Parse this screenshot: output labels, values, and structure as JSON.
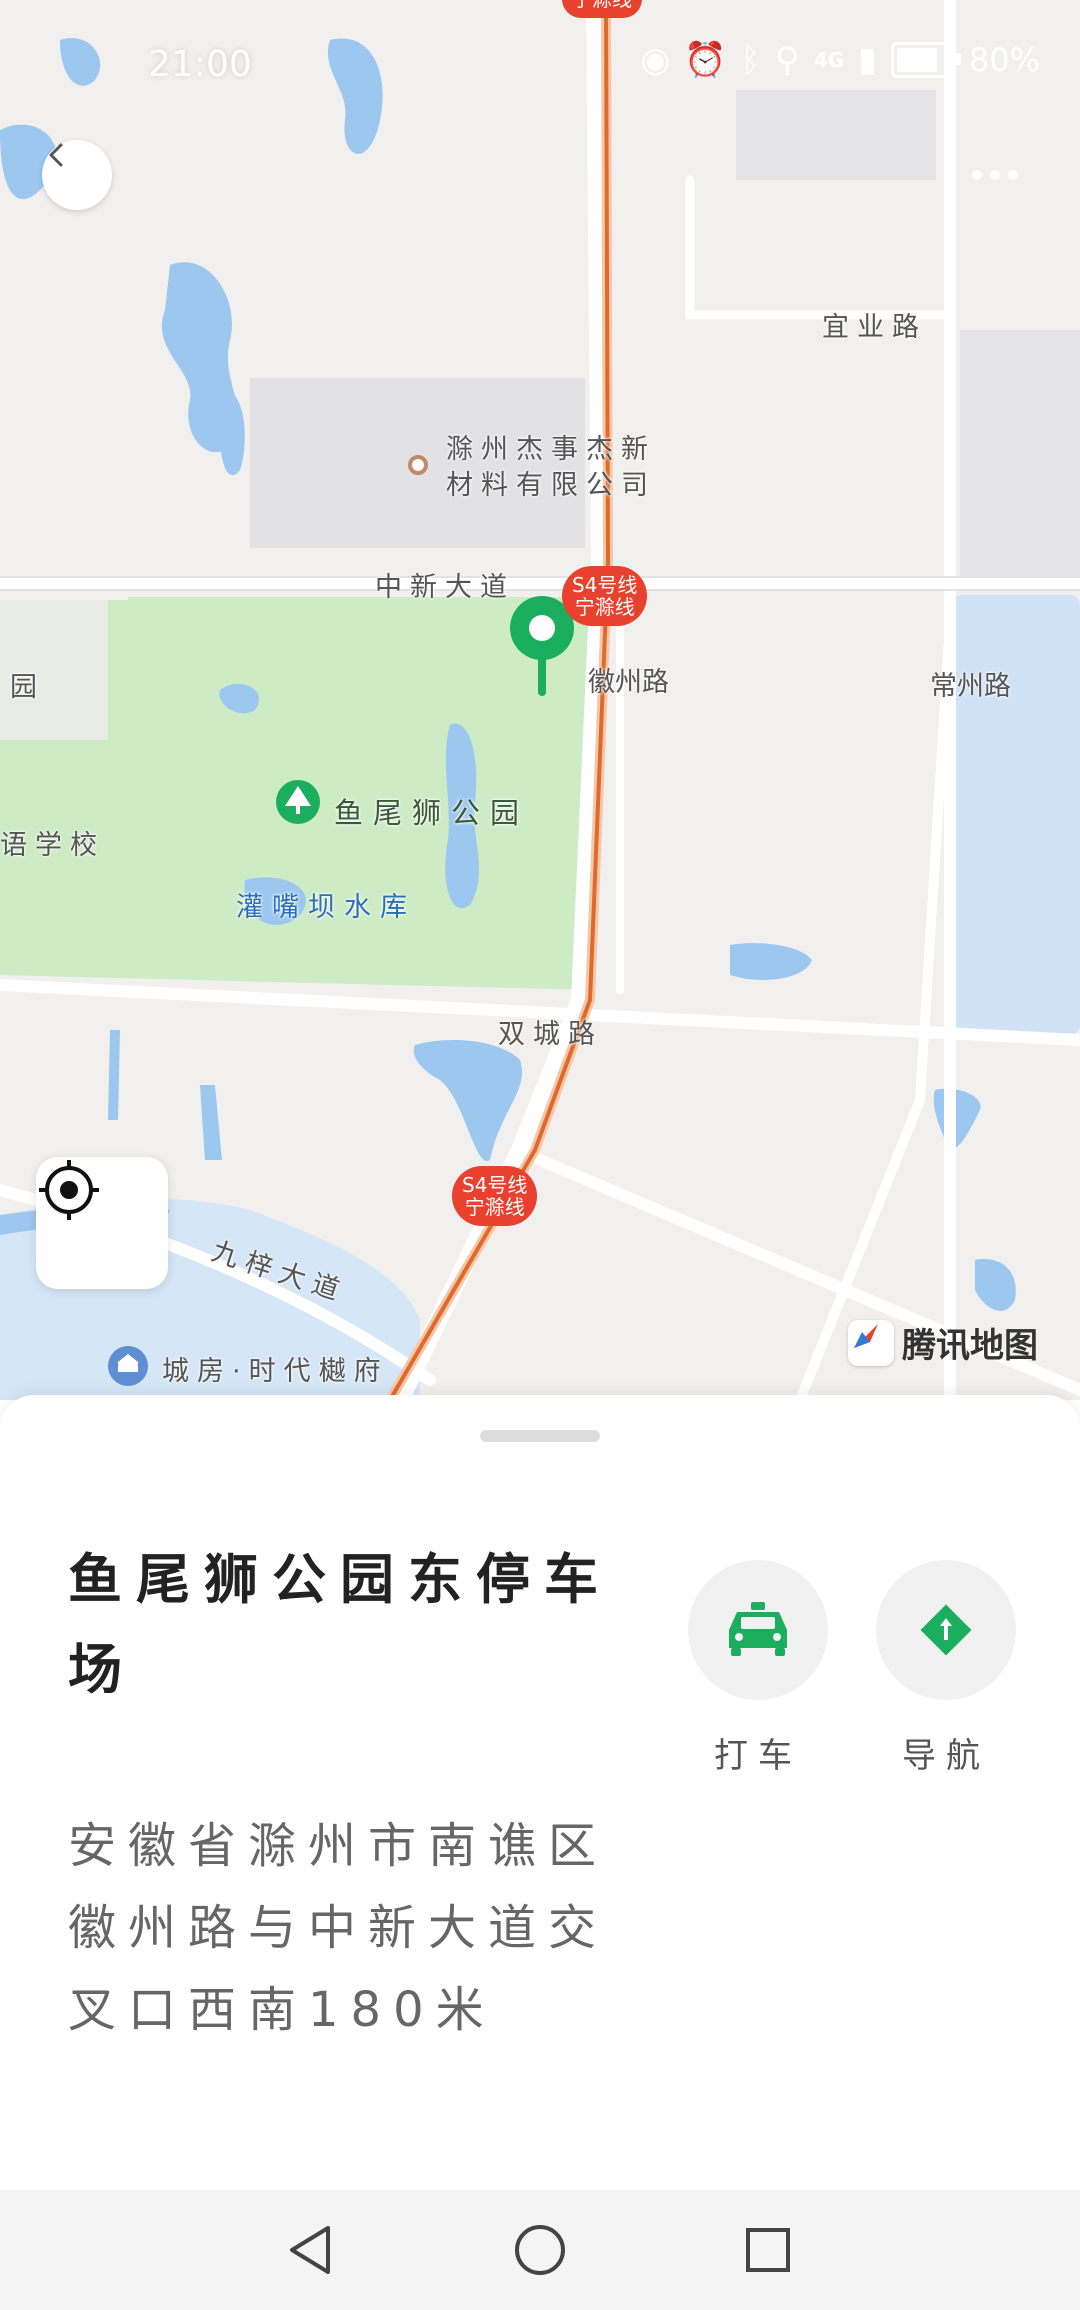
{
  "status_bar": {
    "time": "21:00",
    "battery_text": "80%",
    "battery_level": 0.8,
    "network": "4G",
    "icons": [
      "eye-icon",
      "alarm-icon",
      "bluetooth-icon",
      "location-icon",
      "signal-icon",
      "battery-icon"
    ]
  },
  "map": {
    "brand": "腾讯地图",
    "roads": {
      "yiye": "宜业路",
      "zhongxin": "中新大道",
      "huizhou": "徽州路",
      "changzhou": "常州路",
      "shuangcheng": "双城路",
      "jiuzi": "九梓大道"
    },
    "pois": {
      "company": "滁州杰事杰新材料有限公司",
      "park": "鱼尾狮公园",
      "reservoir": "灌嘴坝水库",
      "school": "语学校",
      "garden": "园",
      "housing": "城房·时代樾府"
    },
    "metro": {
      "line": "S4号线",
      "name": "宁滁线"
    },
    "colors": {
      "metro": "#e8412e",
      "park": "#cdebc4",
      "water": "#9cc7ef",
      "marker": "#1bae5f"
    }
  },
  "sheet": {
    "title": "鱼尾狮公园东停车场",
    "address": "安徽省滁州市南谯区徽州路与中新大道交叉口西南180米",
    "actions": {
      "taxi": "打车",
      "navigate": "导航"
    },
    "colors": {
      "accent": "#1bae5f"
    }
  },
  "nav_bar": {
    "icons": [
      "back-triangle-icon",
      "home-circle-icon",
      "recent-square-icon"
    ]
  }
}
